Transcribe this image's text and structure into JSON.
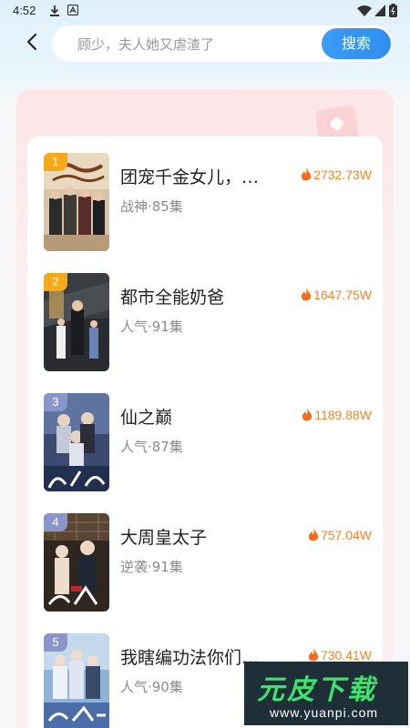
{
  "status_bar": {
    "time": "4:52"
  },
  "search": {
    "placeholder": "顾少，夫人她又虐渣了",
    "button_label": "搜索"
  },
  "rank_list": [
    {
      "rank": "1",
      "title": "团宠千金女儿，…",
      "meta": "战神·85集",
      "heat": "2732.73W",
      "badge_color": "#f7a91c"
    },
    {
      "rank": "2",
      "title": "都市全能奶爸",
      "meta": "人气·91集",
      "heat": "1647.75W",
      "badge_color": "#f7a91c"
    },
    {
      "rank": "3",
      "title": "仙之巅",
      "meta": "人气·87集",
      "heat": "1189.88W",
      "badge_color": "#8a96c9"
    },
    {
      "rank": "4",
      "title": "大周皇太子",
      "meta": "逆袭·91集",
      "heat": "757.04W",
      "badge_color": "#8a96c9"
    },
    {
      "rank": "5",
      "title": "我瞎编功法你们…",
      "meta": "人气·90集",
      "heat": "730.41W",
      "badge_color": "#8a96c9"
    }
  ],
  "watermark": {
    "logo_text": "元皮下载",
    "url": "www.yuanpi.com"
  }
}
